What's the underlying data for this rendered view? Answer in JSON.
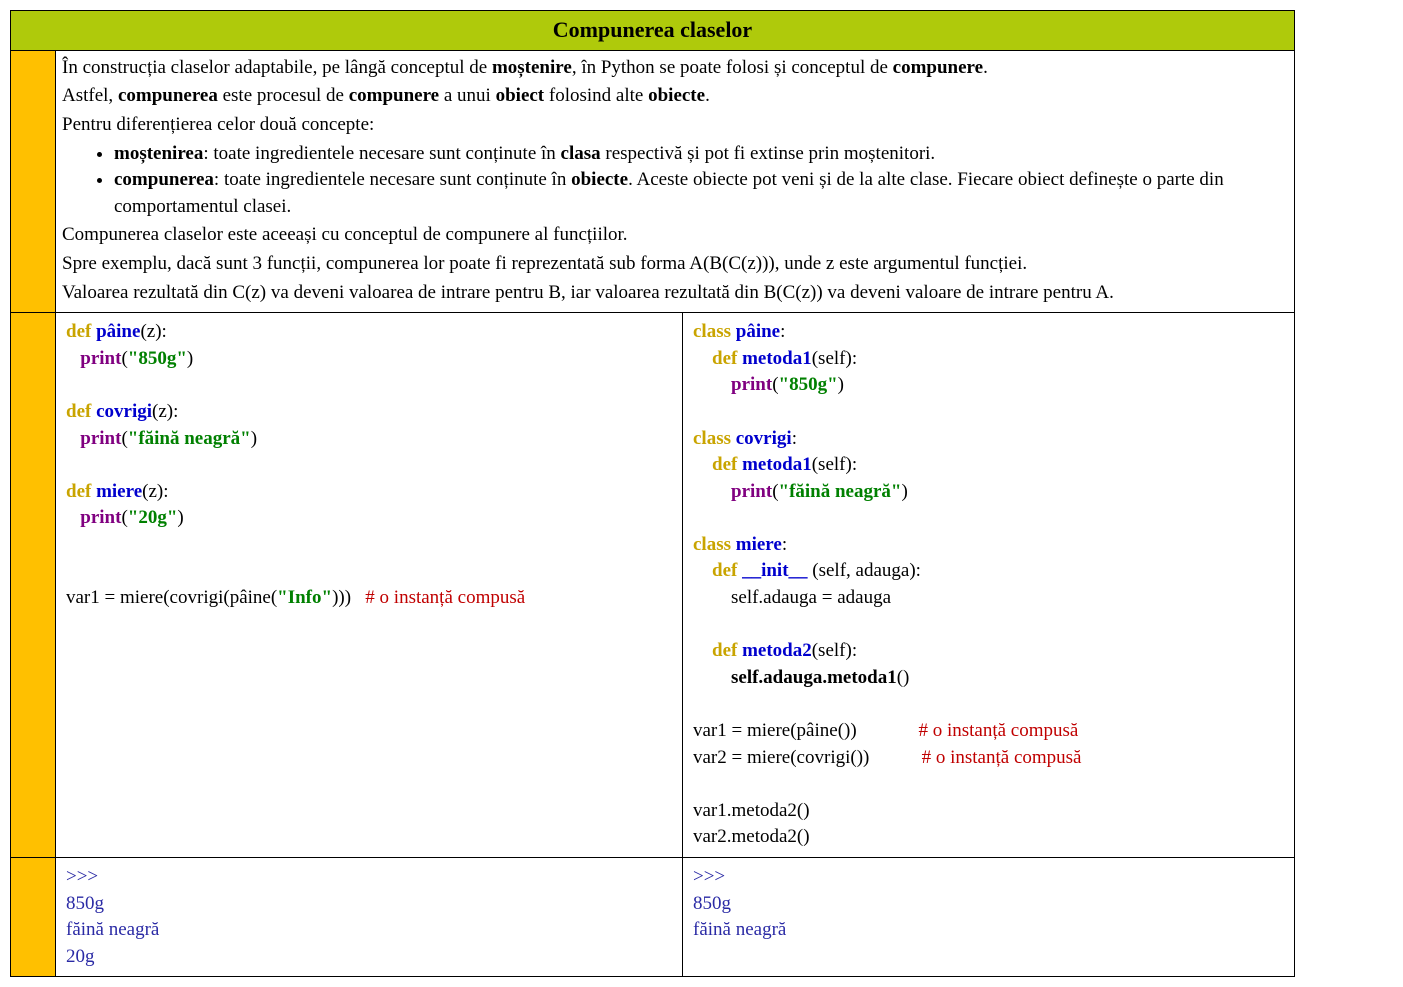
{
  "title": "Compunerea claselor",
  "intro": {
    "p1_a": "În construcția claselor adaptabile, pe lângă conceptul de ",
    "p1_b": "moștenire",
    "p1_c": ", în Python se poate folosi și conceptul de ",
    "p1_d": "compunere",
    "p1_e": ".",
    "p2_a": "Astfel, ",
    "p2_b": "compunerea",
    "p2_c": " este procesul de ",
    "p2_d": "compunere",
    "p2_e": " a unui ",
    "p2_f": "obiect",
    "p2_g": " folosind alte ",
    "p2_h": "obiecte",
    "p2_i": ".",
    "p3": "Pentru diferențierea celor două concepte:",
    "li1_a": "moștenirea",
    "li1_b": ": toate ingredientele necesare sunt conținute în ",
    "li1_c": "clasa",
    "li1_d": " respectivă și pot fi extinse prin moștenitori.",
    "li2_a": "compunerea",
    "li2_b": ":  toate ingredientele necesare sunt conținute în ",
    "li2_c": "obiecte",
    "li2_d": ". Aceste obiecte pot veni și de la alte clase. Fiecare obiect definește o parte din comportamentul clasei.",
    "p4": "Compunerea claselor este aceeași cu conceptul de compunere al funcțiilor.",
    "p5": "Spre exemplu, dacă sunt 3 funcții, compunerea lor poate fi reprezentată sub forma A(B(C(z))), unde z este argumentul funcției.",
    "p6": "Valoarea rezultată din C(z) va deveni valoarea de intrare pentru B, iar valoarea rezultată din B(C(z)) va deveni valoare de intrare pentru A."
  },
  "code": {
    "kw_def": "def",
    "kw_class": "class",
    "fn_paine": "pâine",
    "fn_covrigi": "covrigi",
    "fn_miere": "miere",
    "fn_metoda1": "metoda1",
    "fn_metoda2": "metoda2",
    "fn_init": "__init__",
    "pr": "print",
    "str_850g": "\"850g\"",
    "str_faina": "\"făină neagră\"",
    "str_20g": "\"20g\"",
    "str_info": "\"Info\"",
    "cmt_inst": "# o instanță compusă",
    "left_paren_z": "(z):",
    "left_paren_colon": ":",
    "left_var_line": "var1 = miere(covrigi(pâine(",
    "left_var_line_end": ")))   ",
    "r_self": "(self):",
    "r_init_args": " (self, adauga):",
    "r_self_adauga_assign": "        self.adauga = adauga",
    "r_self_adauga_call": "self.adauga.metoda1",
    "r_call_paren": "()",
    "r_var1": "var1 = miere(pâine())",
    "r_var2": "var2 = miere(covrigi())",
    "r_pad1": "             ",
    "r_pad2": "           ",
    "r_call1": "var1.metoda2()",
    "r_call2": "var2.metoda2()"
  },
  "out": {
    "prompt": ">>>",
    "l850": "850g",
    "lfaina": "făină neagră",
    "l20": "20g"
  }
}
